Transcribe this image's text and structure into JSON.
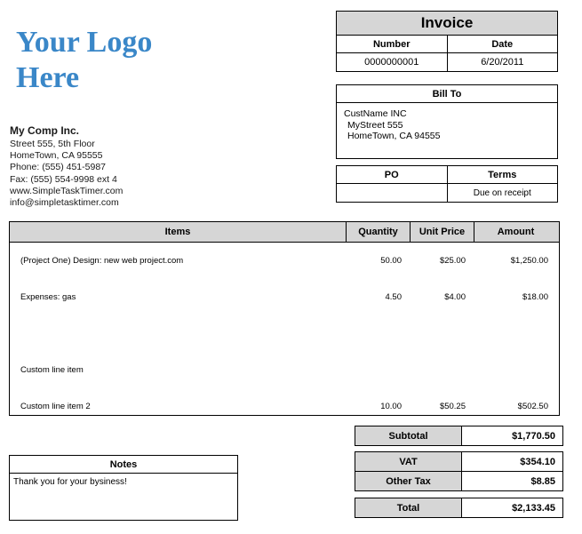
{
  "logo": {
    "line1": "Your Logo",
    "line2": "Here",
    "color": "#3a87c8"
  },
  "company": {
    "name": "My Comp Inc.",
    "street": "Street 555, 5th Floor",
    "city_state_zip": "HomeTown, CA  95555",
    "phone": "Phone: (555) 451-5987",
    "fax": "Fax: (555) 554-9998 ext 4",
    "website": "www.SimpleTaskTimer.com",
    "email": "info@simpletasktimer.com"
  },
  "invoice": {
    "title": "Invoice",
    "number_label": "Number",
    "date_label": "Date",
    "number_value": "0000000001",
    "date_value": "6/20/2011"
  },
  "bill_to": {
    "header": "Bill To",
    "name": "CustName INC",
    "street": "MyStreet 555",
    "city_state_zip": "HomeTown, CA 94555"
  },
  "po_terms": {
    "po_label": "PO",
    "terms_label": "Terms",
    "po_value": "",
    "terms_value": "Due on receipt"
  },
  "items_table": {
    "columns": [
      "Items",
      "Quantity",
      "Unit Price",
      "Amount"
    ],
    "rows": [
      {
        "description": "(Project One) Design: new web project.com",
        "quantity": "50.00",
        "unit_price": "$25.00",
        "amount": "$1,250.00"
      },
      {
        "description": "Expenses: gas",
        "quantity": "4.50",
        "unit_price": "$4.00",
        "amount": "$18.00"
      },
      {
        "description": "",
        "quantity": "",
        "unit_price": "",
        "amount": ""
      },
      {
        "description": "Custom line item",
        "quantity": "",
        "unit_price": "",
        "amount": ""
      },
      {
        "description": "Custom line item 2",
        "quantity": "10.00",
        "unit_price": "$50.25",
        "amount": "$502.50"
      }
    ]
  },
  "notes": {
    "header": "Notes",
    "text": "Thank you for your bysiness!"
  },
  "totals": {
    "subtotal_label": "Subtotal",
    "subtotal_value": "$1,770.50",
    "vat_label": "VAT",
    "vat_value": "$354.10",
    "other_tax_label": "Other Tax",
    "other_tax_value": "$8.85",
    "total_label": "Total",
    "total_value": "$2,133.45"
  },
  "colors": {
    "header_gray": "#d6d6d6",
    "border": "#000000",
    "logo_blue": "#3a87c8",
    "page_background": "#ffffff"
  }
}
